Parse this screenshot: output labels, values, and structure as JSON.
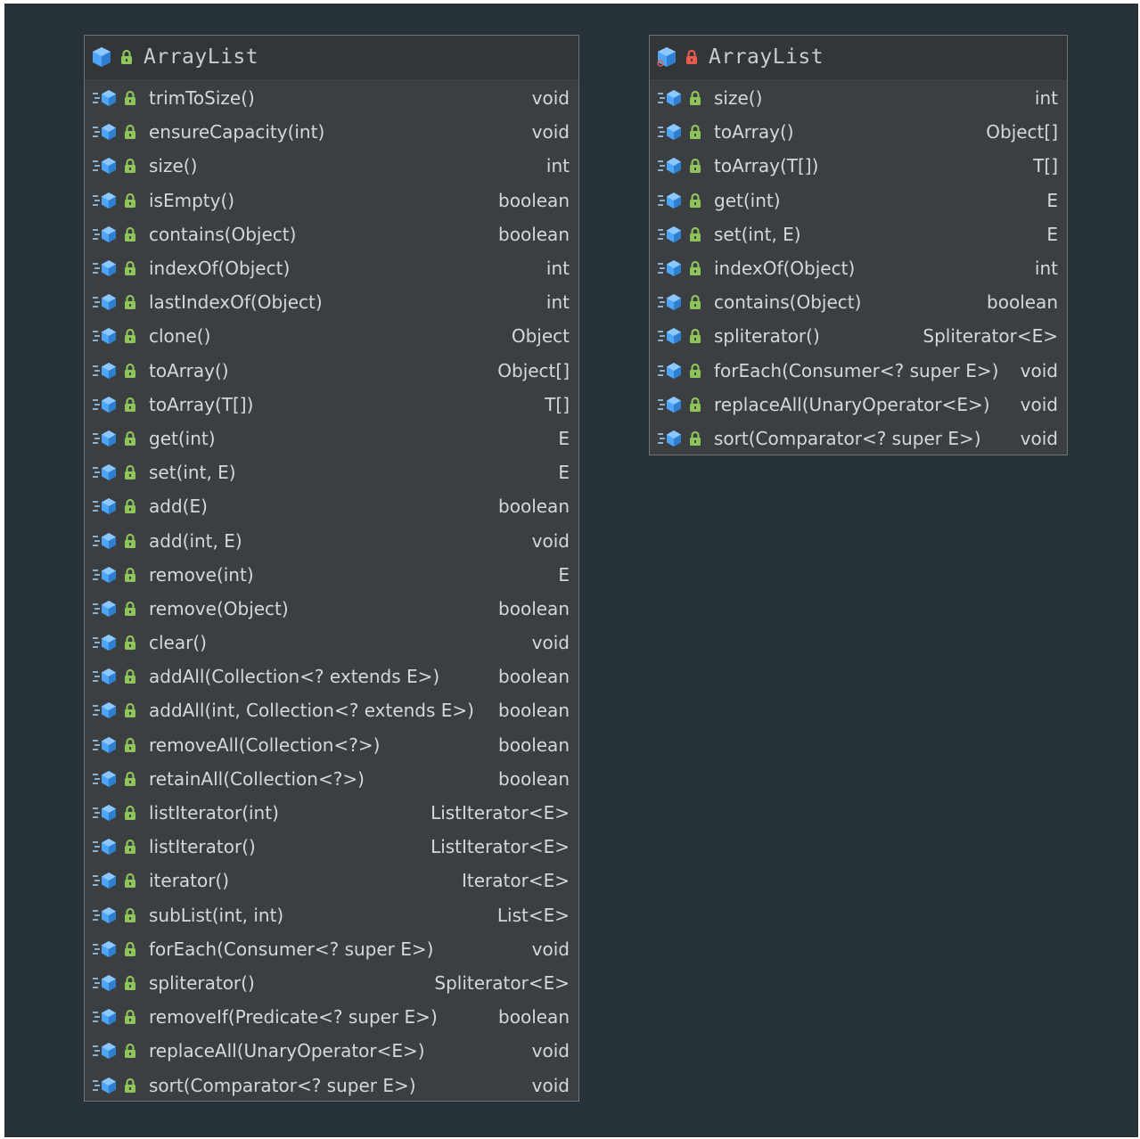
{
  "colors": {
    "background": "#263238",
    "box_fill": "#3c3f41",
    "text": "#d4d8dc",
    "method_icon": "#4ea4f5",
    "lock_green": "#8fc45a",
    "lock_red": "#e8584d"
  },
  "left_box": {
    "title": "ArrayList",
    "header_icons": [
      "class-icon",
      "lock-icon"
    ],
    "methods": [
      {
        "signature": "trimToSize()",
        "return_type": "void"
      },
      {
        "signature": "ensureCapacity(int)",
        "return_type": "void"
      },
      {
        "signature": "size()",
        "return_type": "int"
      },
      {
        "signature": "isEmpty()",
        "return_type": "boolean"
      },
      {
        "signature": "contains(Object)",
        "return_type": "boolean"
      },
      {
        "signature": "indexOf(Object)",
        "return_type": "int"
      },
      {
        "signature": "lastIndexOf(Object)",
        "return_type": "int"
      },
      {
        "signature": "clone()",
        "return_type": "Object"
      },
      {
        "signature": "toArray()",
        "return_type": "Object[]"
      },
      {
        "signature": "toArray(T[])",
        "return_type": "T[]"
      },
      {
        "signature": "get(int)",
        "return_type": "E"
      },
      {
        "signature": "set(int, E)",
        "return_type": "E"
      },
      {
        "signature": "add(E)",
        "return_type": "boolean"
      },
      {
        "signature": "add(int, E)",
        "return_type": "void"
      },
      {
        "signature": "remove(int)",
        "return_type": "E"
      },
      {
        "signature": "remove(Object)",
        "return_type": "boolean"
      },
      {
        "signature": "clear()",
        "return_type": "void"
      },
      {
        "signature": "addAll(Collection<? extends E>)",
        "return_type": "boolean"
      },
      {
        "signature": "addAll(int, Collection<? extends E>)",
        "return_type": "boolean"
      },
      {
        "signature": "removeAll(Collection<?>)",
        "return_type": "boolean"
      },
      {
        "signature": "retainAll(Collection<?>)",
        "return_type": "boolean"
      },
      {
        "signature": "listIterator(int)",
        "return_type": "ListIterator<E>"
      },
      {
        "signature": "listIterator()",
        "return_type": "ListIterator<E>"
      },
      {
        "signature": "iterator()",
        "return_type": "Iterator<E>"
      },
      {
        "signature": "subList(int, int)",
        "return_type": "List<E>"
      },
      {
        "signature": "forEach(Consumer<? super E>)",
        "return_type": "void"
      },
      {
        "signature": "spliterator()",
        "return_type": "Spliterator<E>"
      },
      {
        "signature": "removeIf(Predicate<? super E>)",
        "return_type": "boolean"
      },
      {
        "signature": "replaceAll(UnaryOperator<E>)",
        "return_type": "void"
      },
      {
        "signature": "sort(Comparator<? super E>)",
        "return_type": "void"
      }
    ]
  },
  "right_box": {
    "title": "ArrayList",
    "header_icons": [
      "class-icon",
      "lock-icon"
    ],
    "methods": [
      {
        "signature": "size()",
        "return_type": "int"
      },
      {
        "signature": "toArray()",
        "return_type": "Object[]"
      },
      {
        "signature": "toArray(T[])",
        "return_type": "T[]"
      },
      {
        "signature": "get(int)",
        "return_type": "E"
      },
      {
        "signature": "set(int, E)",
        "return_type": "E"
      },
      {
        "signature": "indexOf(Object)",
        "return_type": "int"
      },
      {
        "signature": "contains(Object)",
        "return_type": "boolean"
      },
      {
        "signature": "spliterator()",
        "return_type": "Spliterator<E>"
      },
      {
        "signature": "forEach(Consumer<? super E>)",
        "return_type": "void"
      },
      {
        "signature": "replaceAll(UnaryOperator<E>)",
        "return_type": "void"
      },
      {
        "signature": "sort(Comparator<? super E>)",
        "return_type": "void"
      }
    ]
  }
}
